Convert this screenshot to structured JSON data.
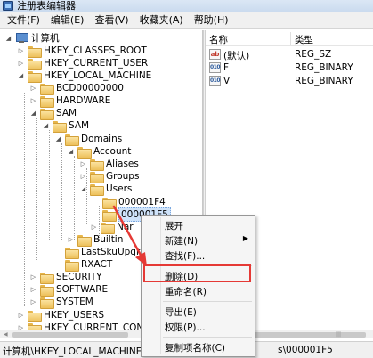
{
  "window": {
    "title": "注册表编辑器"
  },
  "menu": [
    "文件(F)",
    "编辑(E)",
    "查看(V)",
    "收藏夹(A)",
    "帮助(H)"
  ],
  "tree": {
    "root": "计算机",
    "items": [
      {
        "label": "HKEY_CLASSES_ROOT",
        "id": "hkcr"
      },
      {
        "label": "HKEY_CURRENT_USER",
        "id": "hkcu"
      },
      {
        "label": "HKEY_LOCAL_MACHINE",
        "id": "hklm"
      },
      {
        "label": "BCD00000000",
        "id": "bcd"
      },
      {
        "label": "HARDWARE",
        "id": "hardware"
      },
      {
        "label": "SAM",
        "id": "sam"
      },
      {
        "label": "SAM",
        "id": "sam-sam"
      },
      {
        "label": "Domains",
        "id": "domains"
      },
      {
        "label": "Account",
        "id": "account"
      },
      {
        "label": "Aliases",
        "id": "aliases"
      },
      {
        "label": "Groups",
        "id": "groups"
      },
      {
        "label": "Users",
        "id": "users"
      },
      {
        "label": "000001F4",
        "id": "user-1f4"
      },
      {
        "label": "000001F5",
        "id": "user-1f5"
      },
      {
        "label": "Nar",
        "id": "names"
      },
      {
        "label": "Builtin",
        "id": "builtin"
      },
      {
        "label": "LastSkuUpgr",
        "id": "lastsku"
      },
      {
        "label": "RXACT",
        "id": "rxact"
      },
      {
        "label": "SECURITY",
        "id": "security"
      },
      {
        "label": "SOFTWARE",
        "id": "software"
      },
      {
        "label": "SYSTEM",
        "id": "system"
      },
      {
        "label": "HKEY_USERS",
        "id": "hku"
      },
      {
        "label": "HKEY_CURRENT_CONFI",
        "id": "hkcc"
      }
    ]
  },
  "list": {
    "columns": {
      "name": "名称",
      "type": "类型"
    },
    "rows": [
      {
        "icon": "ab",
        "name": "(默认)",
        "type": "REG_SZ"
      },
      {
        "icon": "010",
        "name": "F",
        "type": "REG_BINARY"
      },
      {
        "icon": "010",
        "name": "V",
        "type": "REG_BINARY"
      }
    ]
  },
  "context_menu": {
    "items": [
      "展开",
      "新建(N)",
      "查找(F)...",
      "删除(D)",
      "重命名(R)",
      "导出(E)",
      "权限(P)...",
      "复制项名称(C)"
    ]
  },
  "status": {
    "path_left": "计算机\\HKEY_LOCAL_MACHINE\\SAM",
    "path_right": "s\\000001F5"
  },
  "colors": {
    "highlight": "#e53935",
    "arrow": "#e53935",
    "folder": "#edc05a",
    "selection": "#cfe3fa"
  }
}
